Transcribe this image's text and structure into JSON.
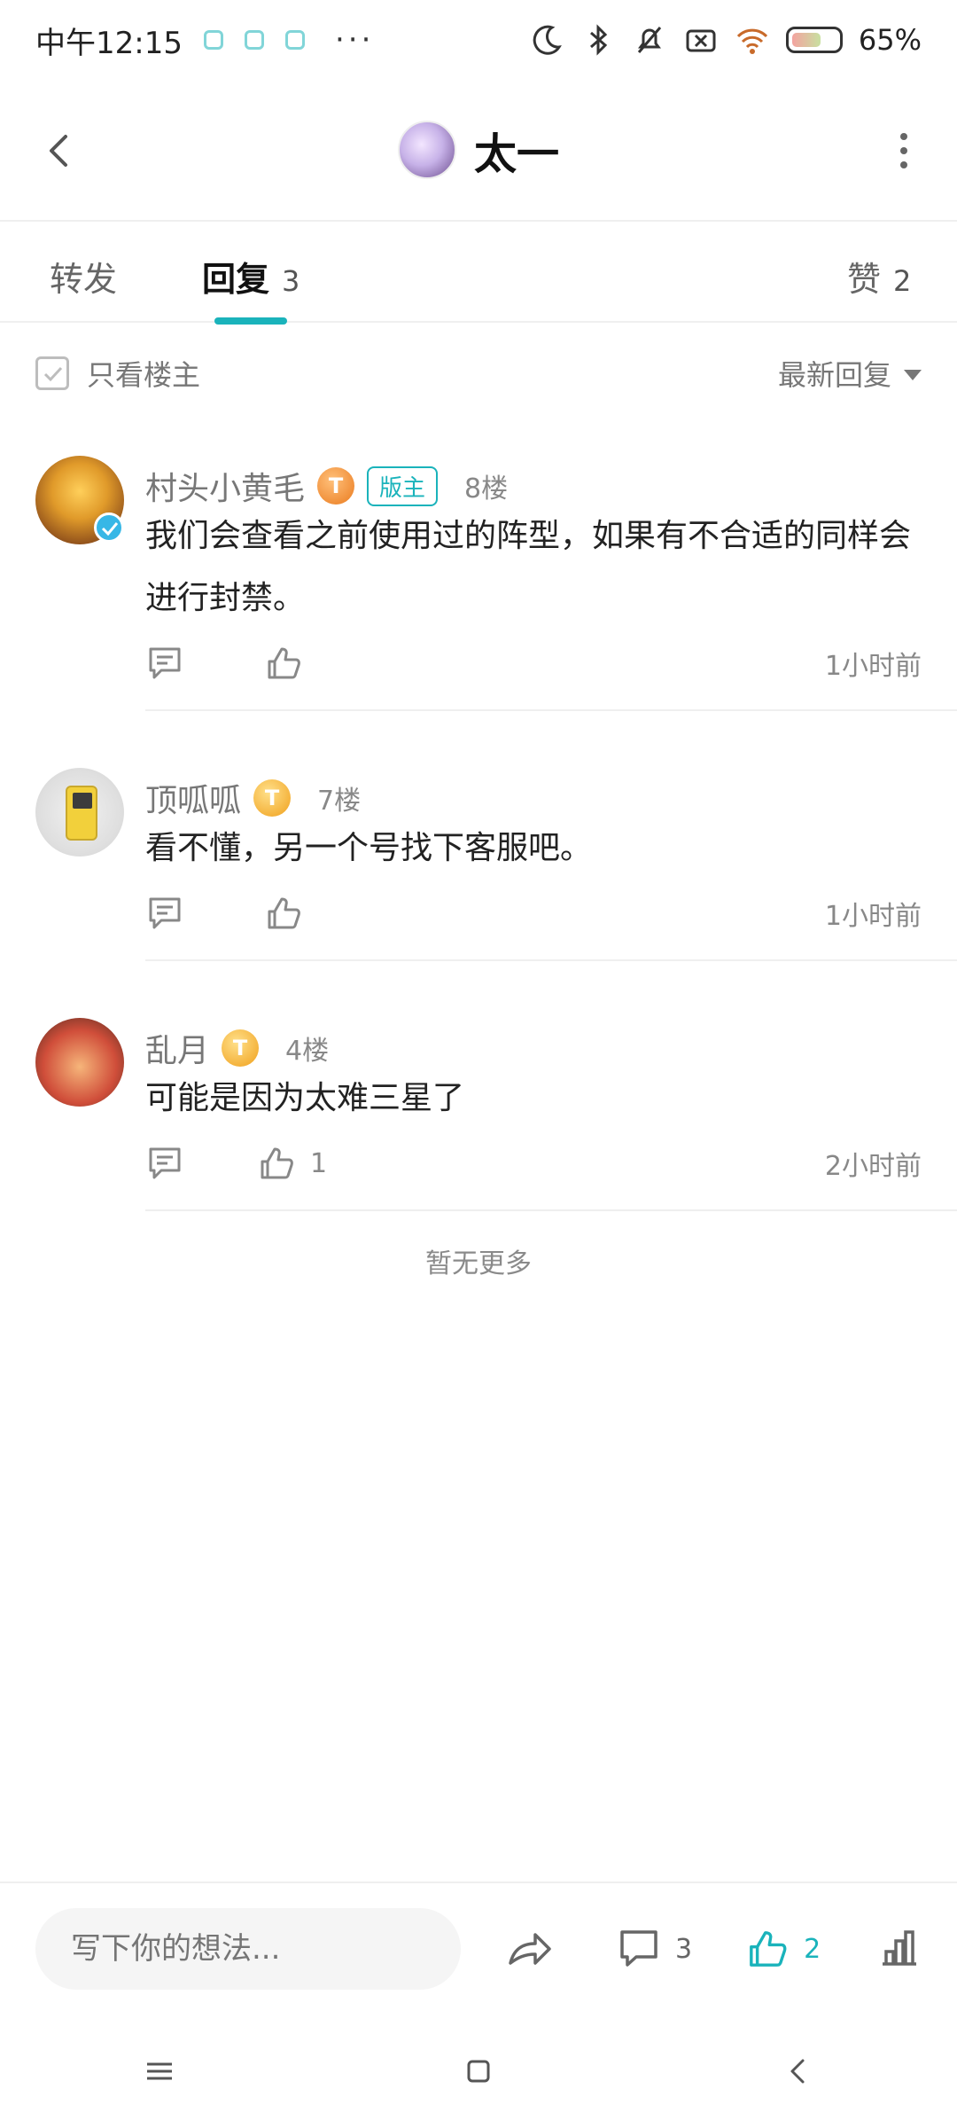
{
  "status_bar": {
    "time": "中午12:15",
    "battery": "65%",
    "battery_level": 0.65
  },
  "header": {
    "title": "太一"
  },
  "tabs": [
    {
      "label": "转发",
      "count": ""
    },
    {
      "label": "回复",
      "count": "3"
    },
    {
      "label": "赞",
      "count": "2"
    }
  ],
  "filter": {
    "only_op_label": "只看楼主",
    "sort_label": "最新回复"
  },
  "comments": [
    {
      "username": "村头小黄毛",
      "level": "T",
      "badge": "版主",
      "floor": "8楼",
      "text": "我们会查看之前使用过的阵型，如果有不合适的同样会进行封禁。",
      "likes": "",
      "time": "1小时前"
    },
    {
      "username": "顶呱呱",
      "level": "T",
      "badge": "",
      "floor": "7楼",
      "text": "看不懂，另一个号找下客服吧。",
      "likes": "",
      "time": "1小时前"
    },
    {
      "username": "乱月",
      "level": "T",
      "badge": "",
      "floor": "4楼",
      "text": "可能是因为太难三星了",
      "likes": "1",
      "time": "2小时前"
    }
  ],
  "no_more_text": "暂无更多",
  "bottom_bar": {
    "input_placeholder": "写下你的想法...",
    "comment_count": "3",
    "like_count": "2"
  },
  "colors": {
    "accent": "#1ab3bb",
    "badge_gold": "#f0a01c",
    "badge_orange": "#ea7b1f"
  }
}
